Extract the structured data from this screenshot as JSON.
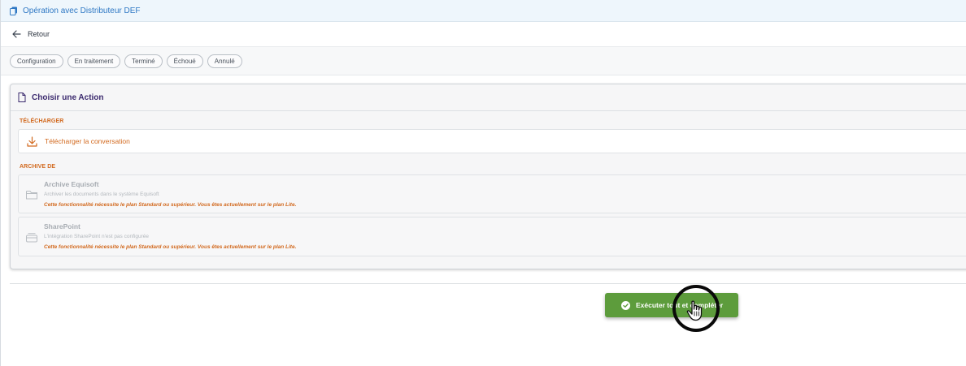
{
  "window": {
    "title": "Opération avec Distributeur DEF"
  },
  "nav": {
    "back_label": "Retour"
  },
  "status_tabs": [
    "Configuration",
    "En traitement",
    "Terminé",
    "Échoué",
    "Annulé"
  ],
  "panel": {
    "title": "Choisir une Action",
    "download_section": {
      "heading": "TÉLÉCHARGER",
      "option_label": "Télécharger la conversation"
    },
    "archive_section": {
      "heading": "ARCHIVE DE",
      "options": [
        {
          "name": "Archive Equisoft",
          "description": "Archiver les documents dans le système Equisoft",
          "warning": "Cette fonctionnalité nécessite le plan Standard ou supérieur. Vous êtes actuellement sur le plan Lite."
        },
        {
          "name": "SharePoint",
          "description": "L'intégration SharePoint n'est pas configurée",
          "warning": "Cette fonctionnalité nécessite le plan Standard ou supérieur. Vous êtes actuellement sur le plan Lite."
        }
      ]
    }
  },
  "actions": {
    "execute_label": "Exécuter tout et compléter"
  },
  "colors": {
    "accent_blue": "#2f78c4",
    "orange": "#d2691e",
    "green_button": "#5d9c3c",
    "panel_title": "#3b2a6e"
  },
  "icons": {
    "title": "document-copy-icon",
    "back": "arrow-left-icon",
    "panel": "document-icon",
    "download": "download-icon",
    "archive": "folder-icon",
    "sharepoint": "tray-icon",
    "execute": "check-circle-icon",
    "cursor": "hand-pointer-icon"
  }
}
